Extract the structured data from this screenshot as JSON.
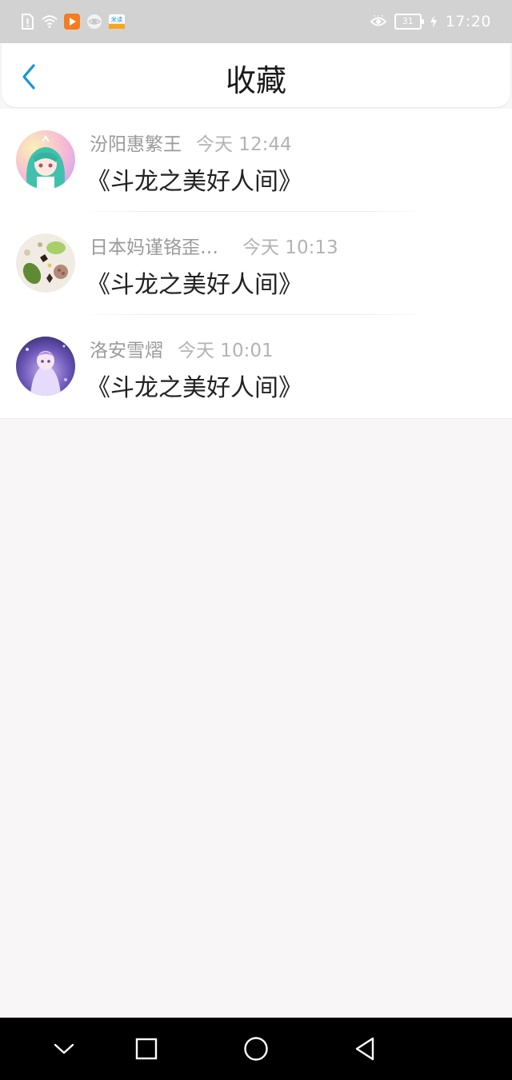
{
  "status_bar": {
    "time": "17:20",
    "battery": "31",
    "app_badge": "米读",
    "icons": [
      "sim-alert-icon",
      "wifi-icon",
      "video-app-icon",
      "browser-app-icon",
      "reader-app-icon",
      "eye-comfort-icon",
      "battery-icon",
      "charging-icon"
    ]
  },
  "header": {
    "title": "收藏",
    "back_icon": "chevron-left-icon"
  },
  "favorites": [
    {
      "author": "汾阳惠繁王",
      "time": "今天 12:44",
      "title": "《斗龙之美好人间》",
      "avatar_palette": [
        "#6ad3c4",
        "#f3a5c9",
        "#f7e0a2"
      ]
    },
    {
      "author": "日本妈谨铬歪…",
      "time": "今天 10:13",
      "title": "《斗龙之美好人间》",
      "avatar_palette": [
        "#8fbf5a",
        "#5b3b2b",
        "#e8dcc8"
      ]
    },
    {
      "author": "洛安雪熠",
      "time": "今天 10:01",
      "title": "《斗龙之美好人间》",
      "avatar_palette": [
        "#2b2b6e",
        "#9c7fd8",
        "#e7d9f5"
      ]
    }
  ],
  "nav_bar": {
    "icons": [
      "chevron-down-icon",
      "recent-apps-icon",
      "home-icon",
      "back-triangle-icon"
    ]
  },
  "colors": {
    "accent": "#1296db",
    "background": "#f8f6f6",
    "status_bar": "#d2d2d2"
  }
}
